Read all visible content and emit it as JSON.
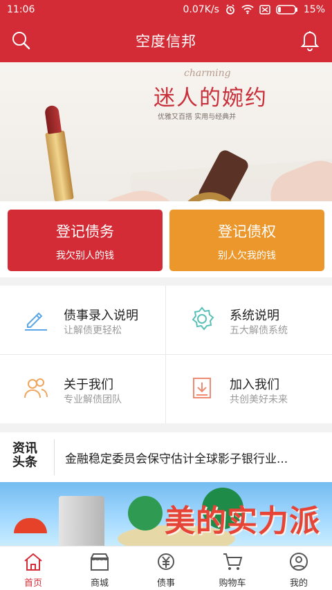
{
  "status_bar": {
    "time": "11:06",
    "network_speed": "0.07K/s",
    "battery": "15%"
  },
  "app_bar": {
    "title": "空度信邦"
  },
  "banner": {
    "script_text": "charming",
    "headline": "迷人的婉约",
    "tagline": "优雅又百搭 实用与经典并"
  },
  "actions": {
    "debt": {
      "main": "登记债务",
      "sub": "我欠别人的钱"
    },
    "credit": {
      "main": "登记债权",
      "sub": "别人欠我的钱"
    }
  },
  "grid": {
    "items": [
      {
        "title": "债事录入说明",
        "desc": "让解债更轻松",
        "icon": "edit-icon"
      },
      {
        "title": "系统说明",
        "desc": "五大解债系统",
        "icon": "gear-icon"
      },
      {
        "title": "关于我们",
        "desc": "专业解债团队",
        "icon": "team-icon"
      },
      {
        "title": "加入我们",
        "desc": "共创美好未来",
        "icon": "join-icon"
      }
    ]
  },
  "news": {
    "logo_line1": "资讯",
    "logo_line2": "头条",
    "headline": "金融稳定委员会保守估计全球影子银行业..."
  },
  "ad": {
    "slogan": "美的实力派"
  },
  "tabbar": {
    "items": [
      {
        "label": "首页",
        "active": true,
        "icon": "home-icon"
      },
      {
        "label": "商城",
        "active": false,
        "icon": "shop-icon"
      },
      {
        "label": "债事",
        "active": false,
        "icon": "debt-icon"
      },
      {
        "label": "购物车",
        "active": false,
        "icon": "cart-icon"
      },
      {
        "label": "我的",
        "active": false,
        "icon": "profile-icon"
      }
    ]
  },
  "colors": {
    "brand_red": "#d42c36",
    "accent_orange": "#ec972c",
    "icon_blue": "#5ba6e6",
    "icon_teal": "#58c1b7",
    "icon_orange": "#f0a55c",
    "icon_salmon": "#ee8a72"
  }
}
